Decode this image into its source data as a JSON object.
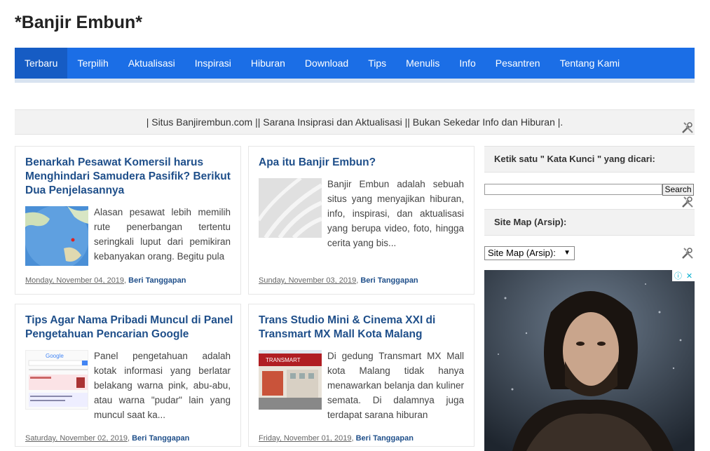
{
  "site": {
    "title": "*Banjir Embun*"
  },
  "nav": {
    "items": [
      {
        "label": "Terbaru",
        "active": true
      },
      {
        "label": "Terpilih"
      },
      {
        "label": "Aktualisasi"
      },
      {
        "label": "Inspirasi"
      },
      {
        "label": "Hiburan"
      },
      {
        "label": "Download"
      },
      {
        "label": "Tips"
      },
      {
        "label": "Menulis"
      },
      {
        "label": "Info"
      },
      {
        "label": "Pesantren"
      },
      {
        "label": "Tentang Kami"
      }
    ]
  },
  "banner": {
    "text": "| Situs Banjirembun.com || Sarana Insiprasi dan Aktualisasi || Bukan Sekedar Info dan Hiburan |."
  },
  "posts": [
    {
      "title": "Benarkah Pesawat Komersil harus Menghindari Samudera Pasifik? Berikut Dua Penjelasannya",
      "excerpt": "Alasan pesawat lebih memilih rute penerbangan tertentu seringkali luput dari pemikiran kebanyakan orang. Begitu pula",
      "date": "Monday, November 04, 2019",
      "comments": "Beri Tanggapan"
    },
    {
      "title": "Apa itu Banjir Embun?",
      "excerpt": "Banjir Embun adalah sebuah situs yang menyajikan hiburan, info, inspirasi, dan aktualisasi yang berupa video, foto, hingga cerita yang bis...",
      "date": "Sunday, November 03, 2019",
      "comments": "Beri Tanggapan"
    },
    {
      "title": "Tips Agar Nama Pribadi Muncul di Panel Pengetahuan Pencarian Google",
      "excerpt": "Panel pengetahuan adalah kotak informasi yang berlatar belakang warna pink, abu-abu, atau warna \"pudar\" lain yang muncul saat ka...",
      "date": "Saturday, November 02, 2019",
      "comments": "Beri Tanggapan"
    },
    {
      "title": "Trans Studio Mini & Cinema XXI di Transmart MX Mall Kota Malang",
      "excerpt": "Di gedung Transmart MX Mall kota Malang  tidak hanya menawarkan belanja dan kuliner semata. Di dalamnya juga terdapat sarana hiburan",
      "date": "Friday, November 01, 2019",
      "comments": "Beri Tanggapan"
    }
  ],
  "sidebar": {
    "search_heading": "Ketik satu \" Kata Kunci \" yang dicari:",
    "search_button": "Search",
    "search_value": "",
    "sitemap_heading": "Site Map (Arsip):",
    "sitemap_selected": "Site Map (Arsip):"
  },
  "icons": {
    "wrench": "wrench-screwdriver-icon",
    "ad_info": "info-icon",
    "ad_close": "close-icon"
  },
  "colors": {
    "nav": "#1b6ee6",
    "link": "#1f4f8a"
  }
}
